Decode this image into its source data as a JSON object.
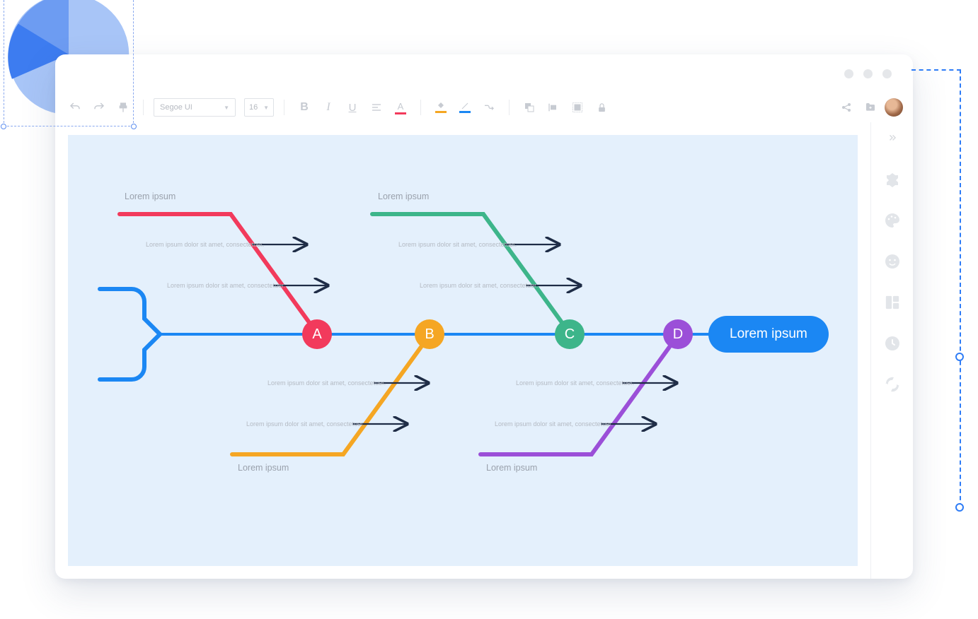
{
  "toolbar": {
    "font_family": "Segoe UI",
    "font_size": "16"
  },
  "diagram": {
    "head_label": "Lorem ipsum",
    "nodes": [
      {
        "id": "A",
        "color": "#f23a5c"
      },
      {
        "id": "B",
        "color": "#f5a623"
      },
      {
        "id": "C",
        "color": "#3db58a"
      },
      {
        "id": "D",
        "color": "#9b4fd8"
      }
    ],
    "branch_titles": {
      "top_left": "Lorem ipsum",
      "top_right": "Lorem ipsum",
      "bottom_left": "Lorem ipsum",
      "bottom_right": "Lorem ipsum"
    },
    "cause_text": "Lorem ipsum dolor sit amet, consectetuer.",
    "colors": {
      "spine": "#1b87f3",
      "arrow": "#1e2c46"
    }
  }
}
